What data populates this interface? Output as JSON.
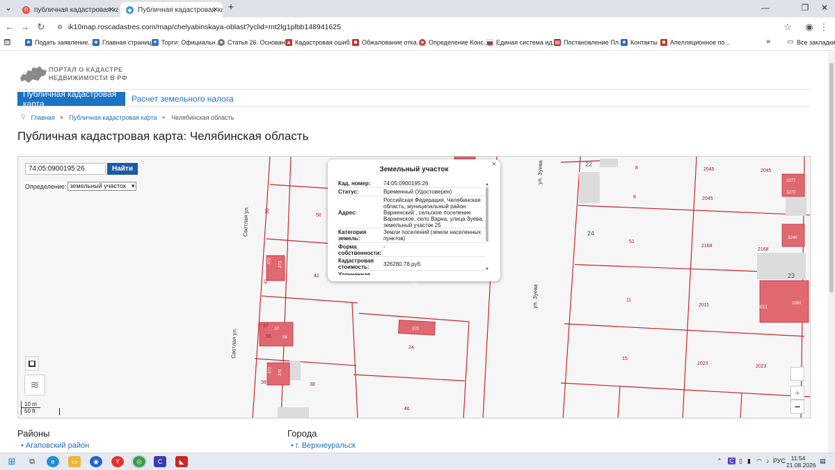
{
  "browser": {
    "tabs": [
      {
        "title": "публичная кадастровая карта",
        "icon": "yandex-icon",
        "active": false
      },
      {
        "title": "Публичная кадастровая карта",
        "icon": "site-icon",
        "active": true
      }
    ],
    "new_tab_label": "+",
    "url": "ik10map.roscadastres.com/map/chelyabinskaya-oblast?yclid=mt2lg1plbb148941625",
    "bookmarks": [
      "Подать заявление...",
      "Главная страница",
      "Торги: Официальн...",
      "Статья 26. Основан...",
      "Кадастровая ошиб...",
      "Обжалование отка...",
      "Определение Конс...",
      "Единая система ид...",
      "Постановление Пл...",
      "Контакты",
      "Апелляционное по..."
    ],
    "bookmarks_more": "»",
    "all_bookmarks": "Все закладки"
  },
  "site": {
    "logo_line1": "ПОРТАЛ О КАДАСТРЕ",
    "logo_line2": "НЕДВИЖИМОСТИ В РФ",
    "nav_active": "Публичная кадастровая карта",
    "nav_other": "Расчет земельного налога",
    "breadcrumbs": [
      "Главная",
      "Публичная кадастровая карта",
      "Челябинская область"
    ],
    "page_title": "Публичная кадастровая карта: Челябинская область",
    "brand_color": "#1a73c4"
  },
  "search": {
    "value": "74:05:0900195:26",
    "button": "Найти",
    "define_label": "Определение:",
    "define_value": "земельный участок"
  },
  "popup": {
    "title": "Земельный участок",
    "close": "×",
    "rows": [
      {
        "key": "Кад. номер:",
        "value": "74:05:0900195:26"
      },
      {
        "key": "Статус:",
        "value": "Временный (Удостоверен)"
      },
      {
        "key": "Адрес:",
        "value": "Российская Федерация, Челябинская область, муниципальный район Варненский , сельское поселение Варненское, село Варна, улица Зуева, земельный участок 25"
      },
      {
        "key": "Категория земель:",
        "value": "Земли поселений (земли населенных пунктов)"
      },
      {
        "key": "Форма собственности:",
        "value": "-"
      },
      {
        "key": "Кадастровая стоимость:",
        "value": "326280.78 руб"
      },
      {
        "key": "Уточненная",
        "value": ""
      }
    ]
  },
  "map": {
    "streets": [
      "Светлая ул.",
      "Светлая ул.",
      "ул. Зуева",
      "ул. Зуева"
    ],
    "parcel_numbers": [
      "50",
      "50",
      "41",
      "41",
      "37",
      "56",
      "38",
      "38",
      "24",
      "46",
      "8",
      "8",
      "22",
      "2045",
      "2045",
      "2045",
      "51",
      "2168",
      "2168",
      "24",
      "11",
      "2011",
      "2011",
      "23",
      "15",
      "2023",
      "2023"
    ],
    "building_numbers": [
      "370",
      "3271",
      "3270",
      "3244",
      "3265",
      "372",
      "373",
      "37",
      "56",
      "371",
      "370"
    ],
    "scale_m": "10 m",
    "scale_ft": "50 ft",
    "zoom_in": "+",
    "zoom_out": "−",
    "line_color": "#c8232c",
    "building_color": "#e06870"
  },
  "below": {
    "districts_heading": "Районы",
    "district_link": "Агаповский район",
    "cities_heading": "Города",
    "city_link": "г. Верхнеуральск"
  },
  "taskbar": {
    "lang": "РУС",
    "time": "11:54",
    "date": "21.08.2026"
  }
}
